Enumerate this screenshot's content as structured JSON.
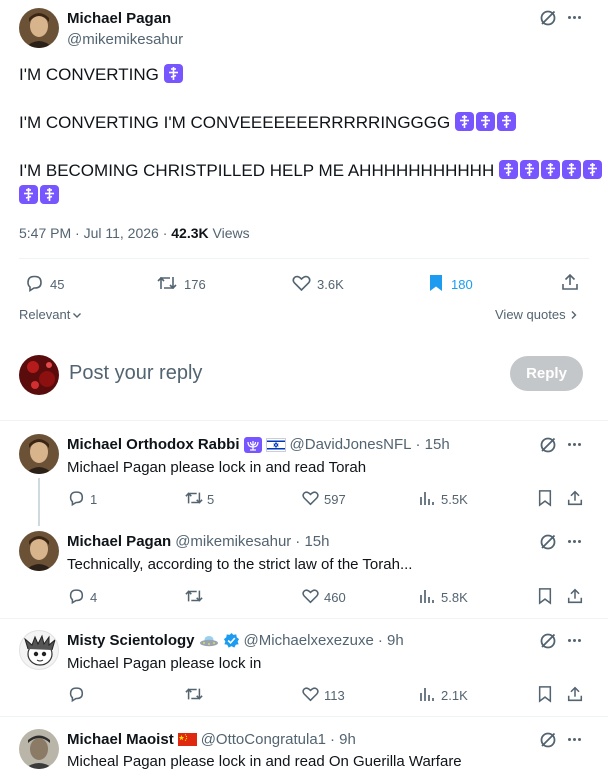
{
  "main_tweet": {
    "author_name": "Michael Pagan",
    "author_handle": "@mikemikesahur",
    "lines": [
      "I'M CONVERTING",
      "I'M CONVERTING I'M CONVEEEEEEERRRRRINGGGG",
      "I'M BECOMING CHRISTPILLED HELP ME AHHHHHHHHHHH"
    ],
    "cross_emoji_counts": [
      1,
      3,
      7
    ],
    "time": "5:47 PM · Jul 11, 2026 ·",
    "views_count": "42.3K",
    "views_label": "Views",
    "stats": {
      "replies": "45",
      "reposts": "176",
      "likes": "3.6K",
      "bookmarks": "180"
    },
    "relevant_label": "Relevant",
    "view_quotes_label": "View quotes"
  },
  "composer": {
    "placeholder": "Post your reply",
    "reply_button": "Reply"
  },
  "replies": [
    {
      "name": "Michael Orthodox Rabbi",
      "flags": [
        "menorah-emoji",
        "israel-flag"
      ],
      "handle": "@DavidJonesNFL",
      "time": "· 15h",
      "text": "Michael Pagan please lock in and read Torah",
      "replies": "1",
      "reposts": "5",
      "likes": "597",
      "views": "5.5K"
    },
    {
      "name": "Michael Pagan",
      "handle": "@mikemikesahur",
      "time": "· 15h",
      "text": "Technically, according to the strict law of the Torah...",
      "replies": "4",
      "reposts": "",
      "likes": "460",
      "views": "5.8K"
    },
    {
      "name": "Misty Scientology",
      "flags": [
        "ufo-emoji",
        "verified-badge"
      ],
      "handle": "@Michaelxexezuxe",
      "time": "· 9h",
      "text": "Michael Pagan please lock in",
      "replies": "",
      "reposts": "",
      "likes": "113",
      "views": "2.1K"
    },
    {
      "name": "Michael Maoist",
      "flags": [
        "china-flag"
      ],
      "handle": "@OttoCongratula1",
      "time": "· 9h",
      "text": "Micheal Pagan please lock in and read On Guerilla Warfare"
    }
  ],
  "colors": {
    "accent": "#1d9bf0",
    "text": "#0f1419",
    "muted": "#536471",
    "divider": "#eff3f4",
    "cross_emoji_bg": "#7856ff",
    "reply_button_bg": "#c3c7ca"
  }
}
